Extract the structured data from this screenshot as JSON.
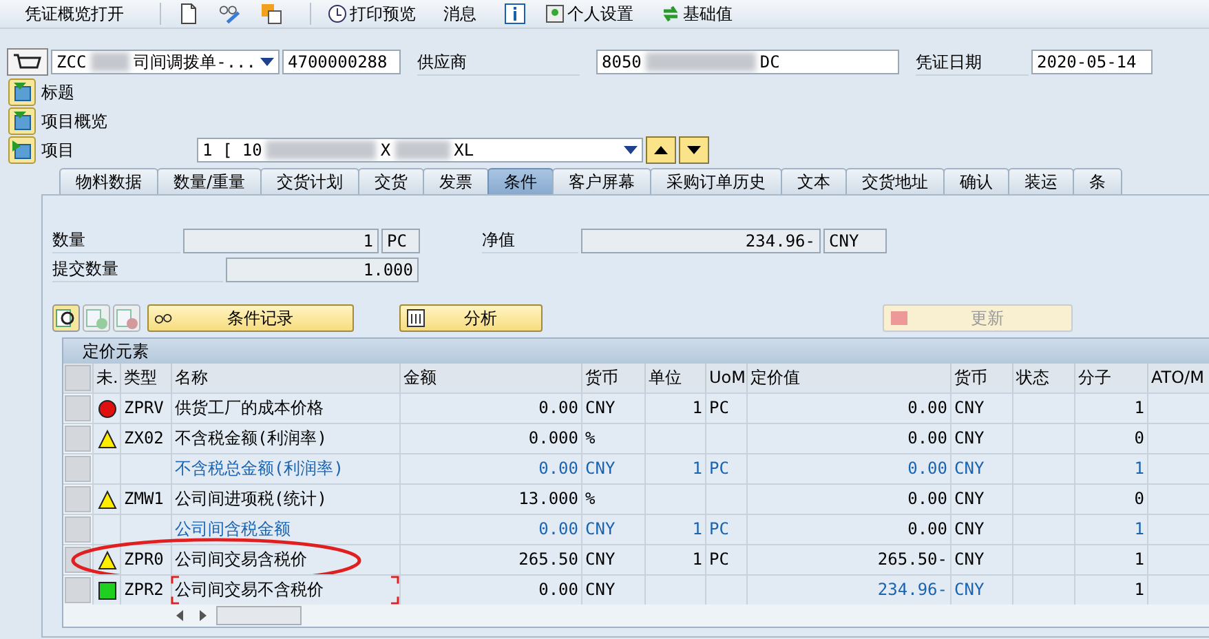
{
  "toolbar": {
    "open_overview": "凭证概览打开",
    "print_preview": "打印预览",
    "messages": "消息",
    "personal_settings": "个人设置",
    "base_value": "基础值"
  },
  "header": {
    "doc_type": {
      "prefix": "ZCC",
      "suffix": "司间调拨单-..."
    },
    "doc_number": "4700000288",
    "vendor_label": "供应商",
    "vendor": {
      "prefix": "8050",
      "suffix": "DC"
    },
    "date_label": "凭证日期",
    "date": "2020-05-14"
  },
  "sections": [
    {
      "label": "标题",
      "expanded": false
    },
    {
      "label": "项目概览",
      "expanded": false
    },
    {
      "label": "项目",
      "expanded": true
    }
  ],
  "item_selector": {
    "prefix": "1 [ 10",
    "middle": "X",
    "suffix": "XL"
  },
  "tabs": [
    {
      "label": "物料数据",
      "selected": false
    },
    {
      "label": "数量/重量",
      "selected": false
    },
    {
      "label": "交货计划",
      "selected": false
    },
    {
      "label": "交货",
      "selected": false
    },
    {
      "label": "发票",
      "selected": false
    },
    {
      "label": "条件",
      "selected": true
    },
    {
      "label": "客户屏幕",
      "selected": false
    },
    {
      "label": "采购订单历史",
      "selected": false
    },
    {
      "label": "文本",
      "selected": false
    },
    {
      "label": "交货地址",
      "selected": false
    },
    {
      "label": "确认",
      "selected": false
    },
    {
      "label": "装运",
      "selected": false
    },
    {
      "label": "条",
      "selected": false
    }
  ],
  "fields": {
    "quantity_label": "数量",
    "quantity": "1",
    "quantity_unit": "PC",
    "net_value_label": "净值",
    "net_value": "234.96-",
    "net_currency": "CNY",
    "submitted_label": "提交数量",
    "submitted": "1.000"
  },
  "row_buttons": [
    {
      "disabled": false
    },
    {
      "disabled": true
    },
    {
      "disabled": true
    }
  ],
  "buttons": {
    "condition_record": "条件记录",
    "analysis": "分析",
    "update": {
      "label": "更新",
      "disabled": true
    }
  },
  "table": {
    "title": "定价元素",
    "columns": [
      "未.",
      "类型",
      "名称",
      "金额",
      "货币",
      "单位",
      "UoM",
      "定价值",
      "货币",
      "状态",
      "分子",
      "ATO/M"
    ],
    "rows": [
      {
        "kind": "error",
        "circled": false,
        "focused": false,
        "cells": [
          null,
          {
            "text": "ZPRV",
            "blue": false
          },
          {
            "text": "供货工厂的成本价格",
            "blue": false
          },
          {
            "text": "0.00",
            "blue": false
          },
          {
            "text": "CNY",
            "blue": false
          },
          {
            "text": "1",
            "blue": false
          },
          {
            "text": "PC",
            "blue": false
          },
          {
            "text": "0.00",
            "blue": false
          },
          {
            "text": "CNY",
            "blue": false
          },
          null,
          {
            "text": "1",
            "blue": false
          },
          null
        ]
      },
      {
        "kind": "warning",
        "circled": false,
        "focused": false,
        "cells": [
          null,
          {
            "text": "ZX02",
            "blue": false
          },
          {
            "text": "不含税金额(利润率)",
            "blue": false
          },
          {
            "text": "0.000",
            "blue": false
          },
          {
            "text": "%",
            "blue": false
          },
          null,
          null,
          {
            "text": "0.00",
            "blue": false
          },
          {
            "text": "CNY",
            "blue": false
          },
          null,
          {
            "text": "0",
            "blue": false
          },
          null
        ]
      },
      {
        "kind": "plain",
        "circled": false,
        "focused": false,
        "cells": [
          null,
          null,
          {
            "text": "不含税总金额(利润率)",
            "blue": true
          },
          {
            "text": "0.00",
            "blue": true
          },
          {
            "text": "CNY",
            "blue": true
          },
          {
            "text": "1",
            "blue": true
          },
          {
            "text": "PC",
            "blue": true
          },
          {
            "text": "0.00",
            "blue": true
          },
          {
            "text": "CNY",
            "blue": true
          },
          null,
          {
            "text": "1",
            "blue": true
          },
          null
        ]
      },
      {
        "kind": "warning",
        "circled": false,
        "focused": false,
        "cells": [
          null,
          {
            "text": "ZMW1",
            "blue": false
          },
          {
            "text": "公司间进项税(统计)",
            "blue": false
          },
          {
            "text": "13.000",
            "blue": false
          },
          {
            "text": "%",
            "blue": false
          },
          null,
          null,
          {
            "text": "0.00",
            "blue": false
          },
          {
            "text": "CNY",
            "blue": false
          },
          null,
          {
            "text": "0",
            "blue": false
          },
          null
        ]
      },
      {
        "kind": "plain",
        "circled": false,
        "focused": false,
        "cells": [
          null,
          null,
          {
            "text": "公司间含税金额",
            "blue": true
          },
          {
            "text": "0.00",
            "blue": true
          },
          {
            "text": "CNY",
            "blue": true
          },
          {
            "text": "1",
            "blue": true
          },
          {
            "text": "PC",
            "blue": true
          },
          {
            "text": "0.00",
            "blue": false
          },
          {
            "text": "CNY",
            "blue": false
          },
          null,
          {
            "text": "1",
            "blue": true
          },
          null
        ]
      },
      {
        "kind": "warning",
        "circled": true,
        "focused": false,
        "cells": [
          null,
          {
            "text": "ZPR0",
            "blue": false
          },
          {
            "text": "公司间交易含税价",
            "blue": false
          },
          {
            "text": "265.50",
            "blue": false
          },
          {
            "text": "CNY",
            "blue": false
          },
          {
            "text": "1",
            "blue": false
          },
          {
            "text": "PC",
            "blue": false
          },
          {
            "text": "265.50-",
            "blue": false
          },
          {
            "text": "CNY",
            "blue": false
          },
          null,
          {
            "text": "1",
            "blue": false
          },
          null
        ]
      },
      {
        "kind": "success",
        "circled": false,
        "focused": true,
        "cells": [
          null,
          {
            "text": "ZPR2",
            "blue": false
          },
          {
            "text": "公司间交易不含税价",
            "blue": false
          },
          {
            "text": "0.00",
            "blue": false
          },
          {
            "text": "CNY",
            "blue": false
          },
          null,
          null,
          {
            "text": "234.96-",
            "blue": true
          },
          {
            "text": "CNY",
            "blue": true
          },
          null,
          {
            "text": "1",
            "blue": false
          },
          null
        ]
      }
    ]
  }
}
